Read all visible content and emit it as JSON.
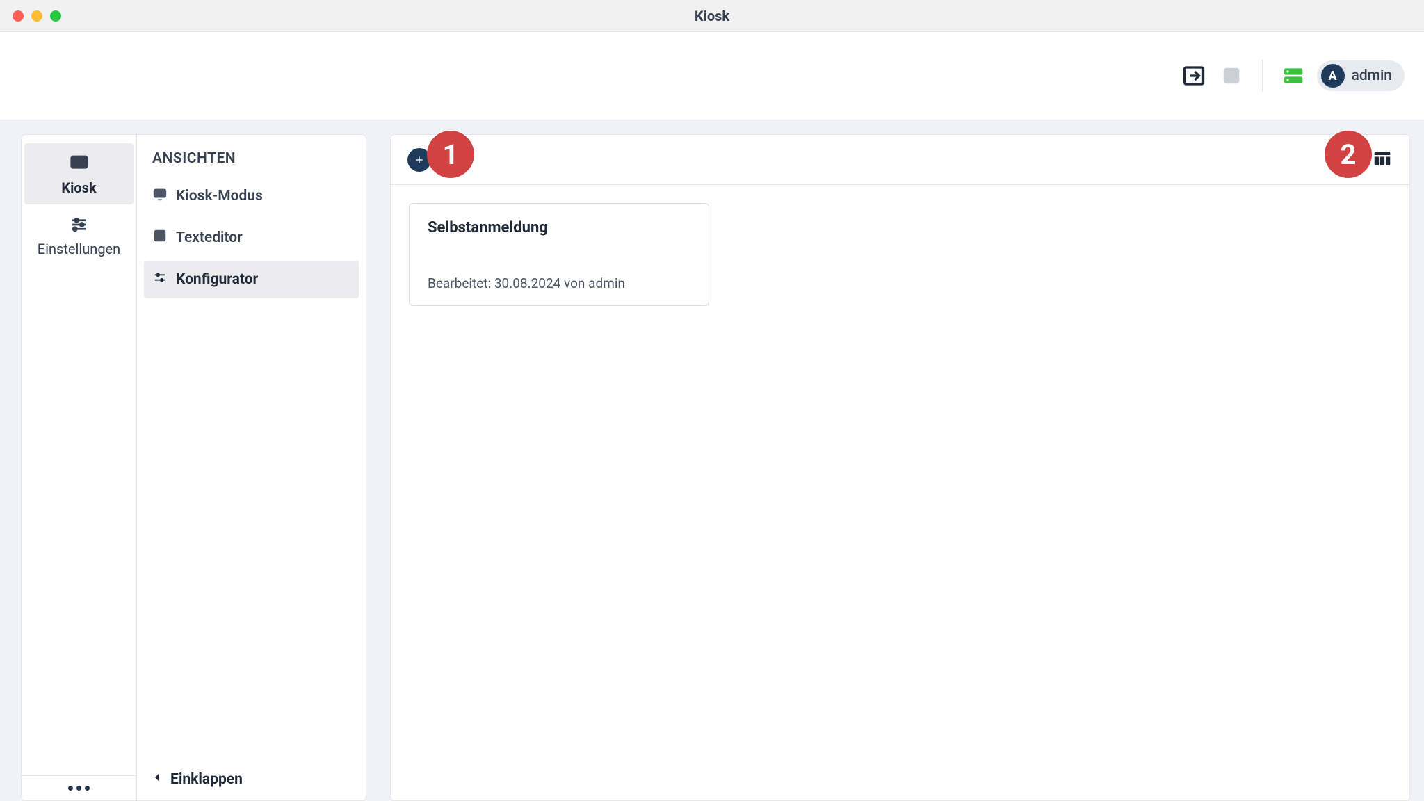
{
  "window": {
    "title": "Kiosk"
  },
  "topbar": {
    "user": {
      "initial": "A",
      "name": "admin"
    }
  },
  "narrow_sidebar": {
    "items": [
      {
        "label": "Kiosk",
        "icon": "monitor",
        "active": true
      },
      {
        "label": "Einstellungen",
        "icon": "sliders",
        "active": false
      }
    ]
  },
  "second_sidebar": {
    "header": "ANSICHTEN",
    "items": [
      {
        "label": "Kiosk-Modus",
        "icon": "monitor"
      },
      {
        "label": "Texteditor",
        "icon": "texteditor"
      },
      {
        "label": "Konfigurator",
        "icon": "sliders",
        "active": true
      }
    ],
    "collapse_label": "Einklappen"
  },
  "content": {
    "annotations": [
      {
        "n": "1"
      },
      {
        "n": "2"
      }
    ],
    "cards": [
      {
        "title": "Selbstanmeldung",
        "meta": "Bearbeitet: 30.08.2024 von admin"
      }
    ]
  }
}
